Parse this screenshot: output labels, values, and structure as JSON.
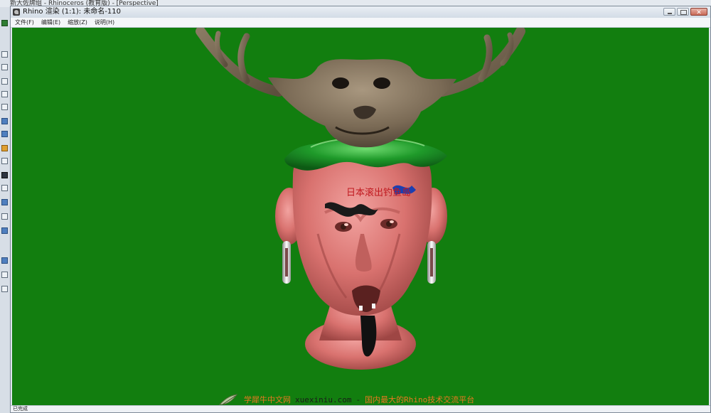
{
  "background_app": {
    "title": "新大佐牌组 - Rhinoceros (教育版) - [Perspective]"
  },
  "window": {
    "title": "Rhino 渲染 (1:1): 未命名-110",
    "buttons": {
      "minimize": "minimize",
      "maximize": "maximize",
      "close": "✕"
    }
  },
  "menu": [
    {
      "label": "文件(F)"
    },
    {
      "label": "编辑(E)"
    },
    {
      "label": "缩放(Z)"
    },
    {
      "label": "说明(H)"
    }
  ],
  "viewport": {
    "background_color": "#127e0f",
    "forehead_text": "日本滚出钓鱼岛"
  },
  "status": {
    "text": "已完成"
  },
  "watermark": {
    "site": "学犀牛中文网",
    "url": "xuexiniu.com",
    "dash": "-",
    "slogan": "国内最大的Rhino技术交流平台"
  },
  "colors": {
    "skin": "#d9726f",
    "antler": "#7a6a55",
    "collar": "#1f9a2a",
    "viewport": "#127e0f"
  }
}
